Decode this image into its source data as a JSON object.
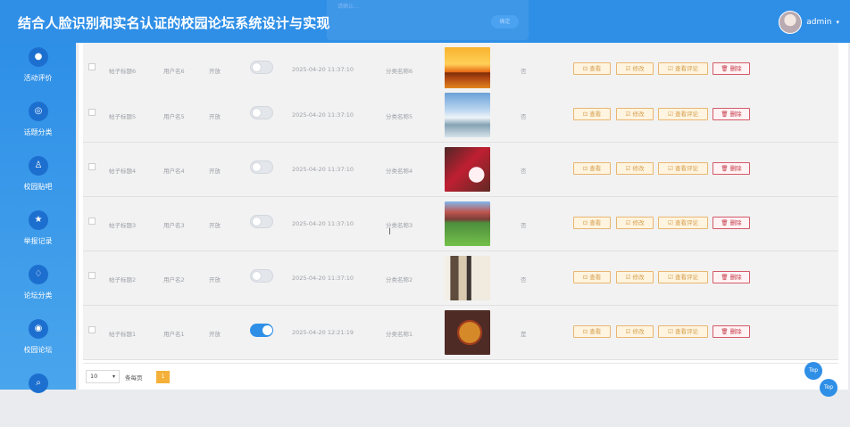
{
  "header": {
    "title": "结合人脸识别和实名认证的校园论坛系统设计与实现",
    "username": "admin",
    "caret": "▾",
    "overlay_text": "请确认…",
    "overlay_button": "确定"
  },
  "sidebar": {
    "items": [
      {
        "label": "活动评价",
        "icon": "chat-icon",
        "glyph": "●"
      },
      {
        "label": "话题分类",
        "icon": "circle-icon",
        "glyph": "◎"
      },
      {
        "label": "校园贴吧",
        "icon": "user-icon",
        "glyph": "♙"
      },
      {
        "label": "举报记录",
        "icon": "star-icon",
        "glyph": "★"
      },
      {
        "label": "论坛分类",
        "icon": "thumb-icon",
        "glyph": "♢"
      },
      {
        "label": "校园论坛",
        "icon": "eye-icon",
        "glyph": "◉"
      },
      {
        "label": "",
        "icon": "search-icon",
        "glyph": "⌕"
      }
    ]
  },
  "table": {
    "rows": [
      {
        "title": "帖子标题6",
        "user": "用户名6",
        "status": "开放",
        "switch_on": false,
        "time": "2025-04-20 11:37:10",
        "category": "分类名称6",
        "image": "sunset",
        "flag": "否"
      },
      {
        "title": "帖子标题5",
        "user": "用户名5",
        "status": "开放",
        "switch_on": false,
        "time": "2025-04-20 11:37:10",
        "category": "分类名称5",
        "image": "mountain",
        "flag": "否"
      },
      {
        "title": "帖子标题4",
        "user": "用户名4",
        "status": "开放",
        "switch_on": false,
        "time": "2025-04-20 11:37:10",
        "category": "分类名称4",
        "image": "cake",
        "flag": "否"
      },
      {
        "title": "帖子标题3",
        "user": "用户名3",
        "status": "开放",
        "switch_on": false,
        "time": "2025-04-20 11:37:10",
        "category": "分类名称3",
        "image": "campus",
        "flag": "否"
      },
      {
        "title": "帖子标题2",
        "user": "用户名2",
        "status": "开放",
        "switch_on": false,
        "time": "2025-04-20 11:37:10",
        "category": "分类名称2",
        "image": "books",
        "flag": "否"
      },
      {
        "title": "帖子标题1",
        "user": "用户名1",
        "status": "开放",
        "switch_on": true,
        "time": "2025-04-20 12:21:19",
        "category": "分类名称1",
        "image": "pizza",
        "flag": "是"
      }
    ],
    "actions": {
      "view": "⊡ 查看",
      "edit": "☑ 修改",
      "comments": "☑ 查看评论",
      "delete": "🗑 删除"
    }
  },
  "pagination": {
    "page_size": "10",
    "select_arrow": "▾",
    "per_page": "条每页",
    "current": "1"
  },
  "top_buttons": {
    "top1": "Top",
    "top2": "Top"
  },
  "colors": {
    "accent": "#2f8fe7",
    "header": "#2f8fe7",
    "pagination": "#f4b038",
    "edit_border": "#e9b672",
    "delete_border": "#d45a68"
  }
}
